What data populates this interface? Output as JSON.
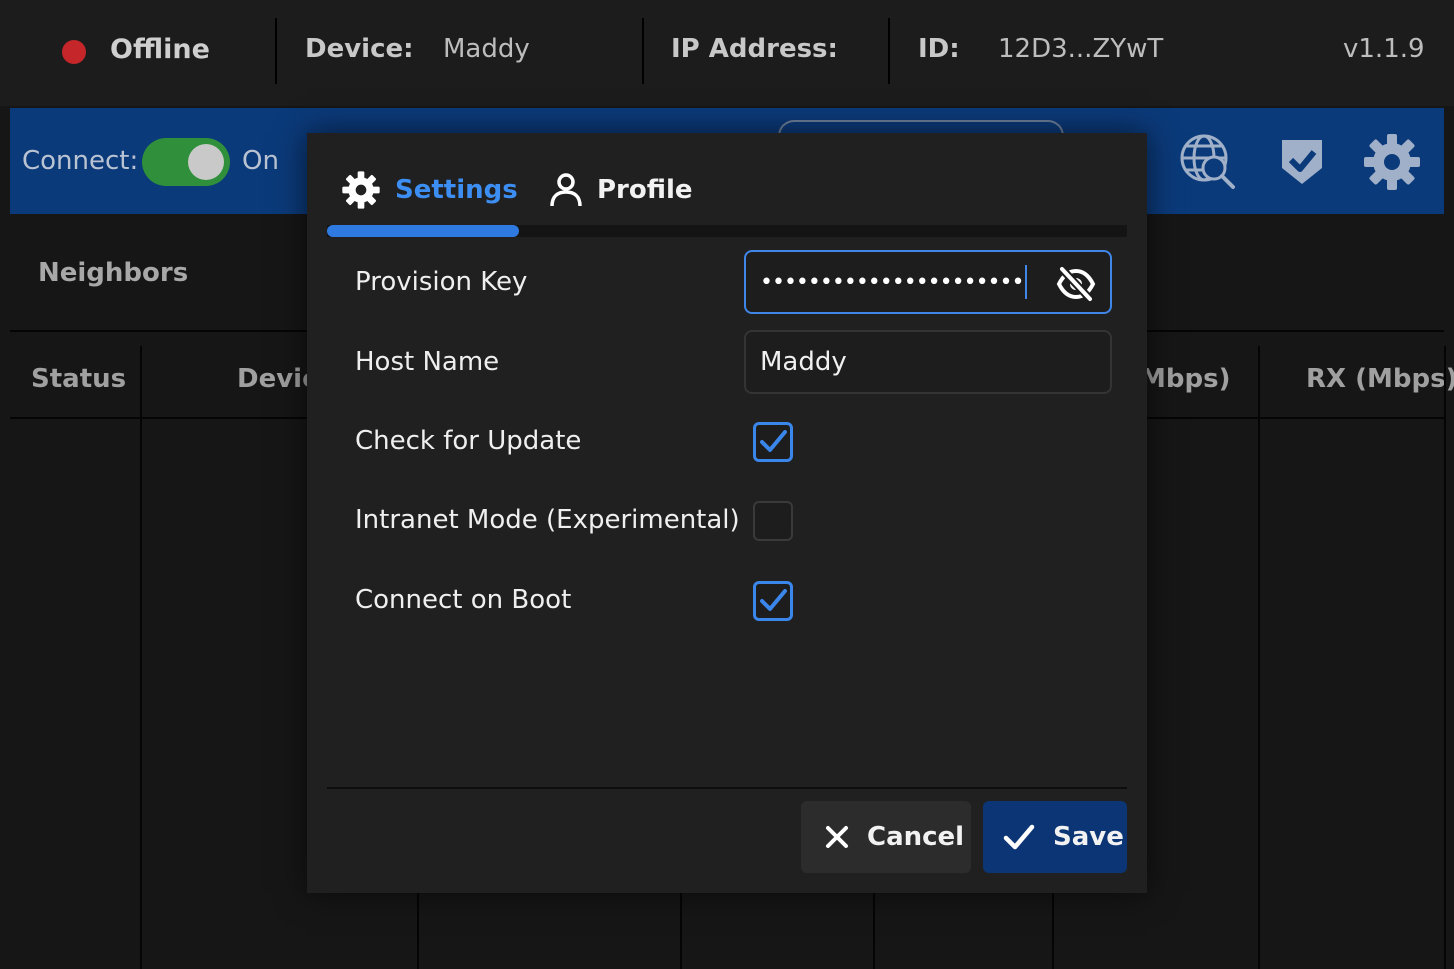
{
  "topbar": {
    "status": "Offline",
    "device_label": "Device:",
    "device_value": "Maddy",
    "ip_label": "IP Address:",
    "ip_value": "",
    "id_label": "ID:",
    "id_value": "12D3...ZYwT",
    "version": "v1.1.9",
    "status_color": "#c4262a"
  },
  "toolbar": {
    "connect_label": "Connect:",
    "connect_state": "On",
    "connect_enabled": true,
    "icons": [
      "globe-search-icon",
      "shield-check-icon",
      "gear-icon"
    ],
    "background": "#0b3a7a"
  },
  "background": {
    "section_title": "Neighbors",
    "columns": [
      "Status",
      "Devic",
      "Mbps)",
      "RX (Mbps)"
    ]
  },
  "modal": {
    "tabs": [
      {
        "label": "Settings",
        "icon": "gear-icon",
        "active": true
      },
      {
        "label": "Profile",
        "icon": "person-icon",
        "active": false
      }
    ],
    "fields": {
      "provision_key": {
        "label": "Provision Key",
        "value": "••••••••••••••••••••••"
      },
      "host_name": {
        "label": "Host Name",
        "value": "Maddy"
      },
      "check_update": {
        "label": "Check for Update",
        "checked": true
      },
      "intranet_mode": {
        "label": "Intranet Mode (Experimental)",
        "checked": false
      },
      "connect_boot": {
        "label": "Connect on Boot",
        "checked": true
      }
    },
    "buttons": {
      "cancel": "Cancel",
      "save": "Save"
    },
    "accent": "#3a86ea"
  }
}
